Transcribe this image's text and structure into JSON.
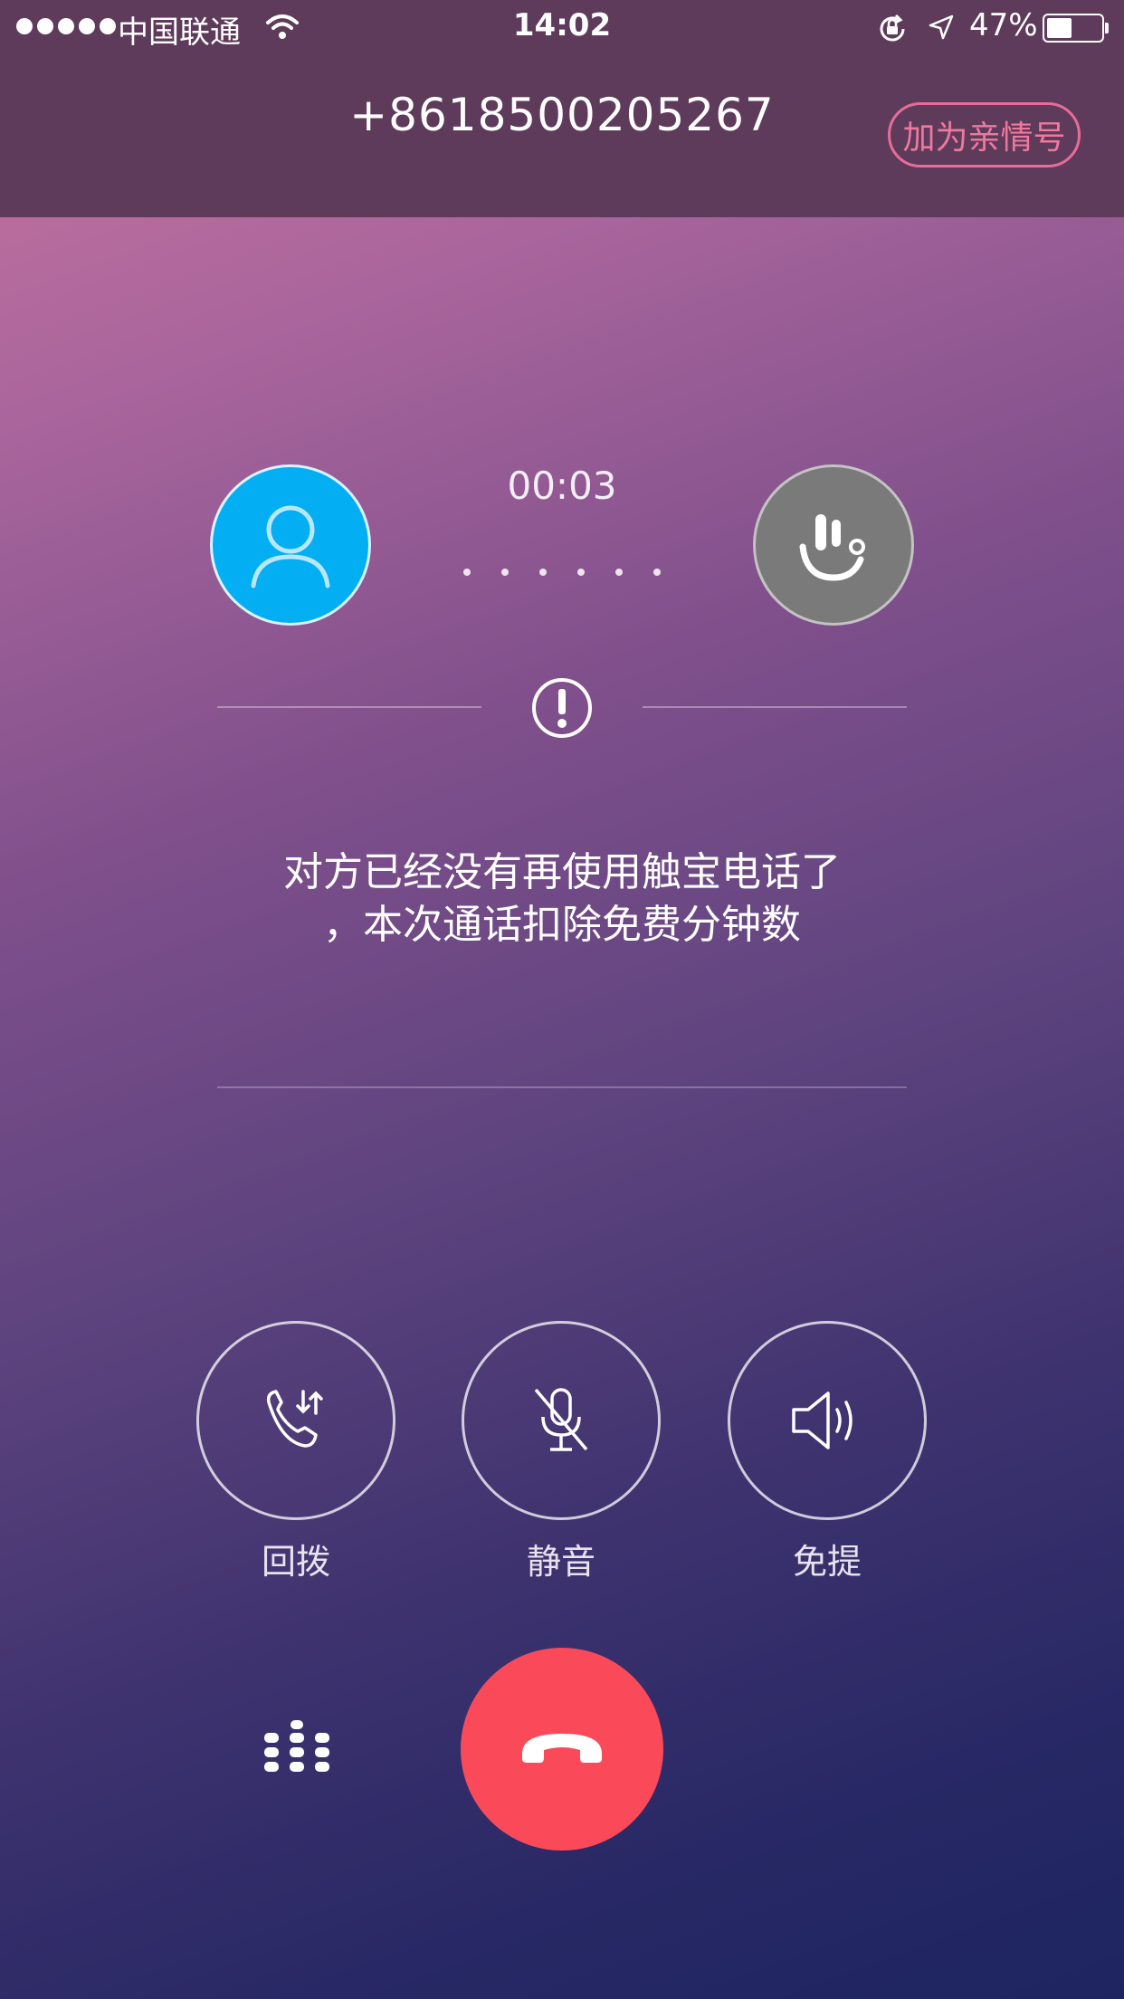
{
  "status_bar": {
    "carrier": "中国联通",
    "time": "14:02",
    "battery": "47%",
    "battery_level": 0.47
  },
  "header": {
    "phone_number": "+8618500205267",
    "add_family_label": "加为亲情号"
  },
  "call": {
    "duration": "00:03",
    "message_line1": "对方已经没有再使用触宝电话了",
    "message_line2": "，本次通话扣除免费分钟数"
  },
  "actions": [
    {
      "label": "回拨",
      "icon": "callback-icon"
    },
    {
      "label": "静音",
      "icon": "mic-muted-icon"
    },
    {
      "label": "免提",
      "icon": "speaker-icon"
    }
  ],
  "colors": {
    "header_bg": "#5e3b5a",
    "accent_pink": "#f0789f",
    "avatar_blue": "#03aef2",
    "avatar_gray": "#7a7a7a",
    "hangup_red": "#fa4a5a"
  }
}
